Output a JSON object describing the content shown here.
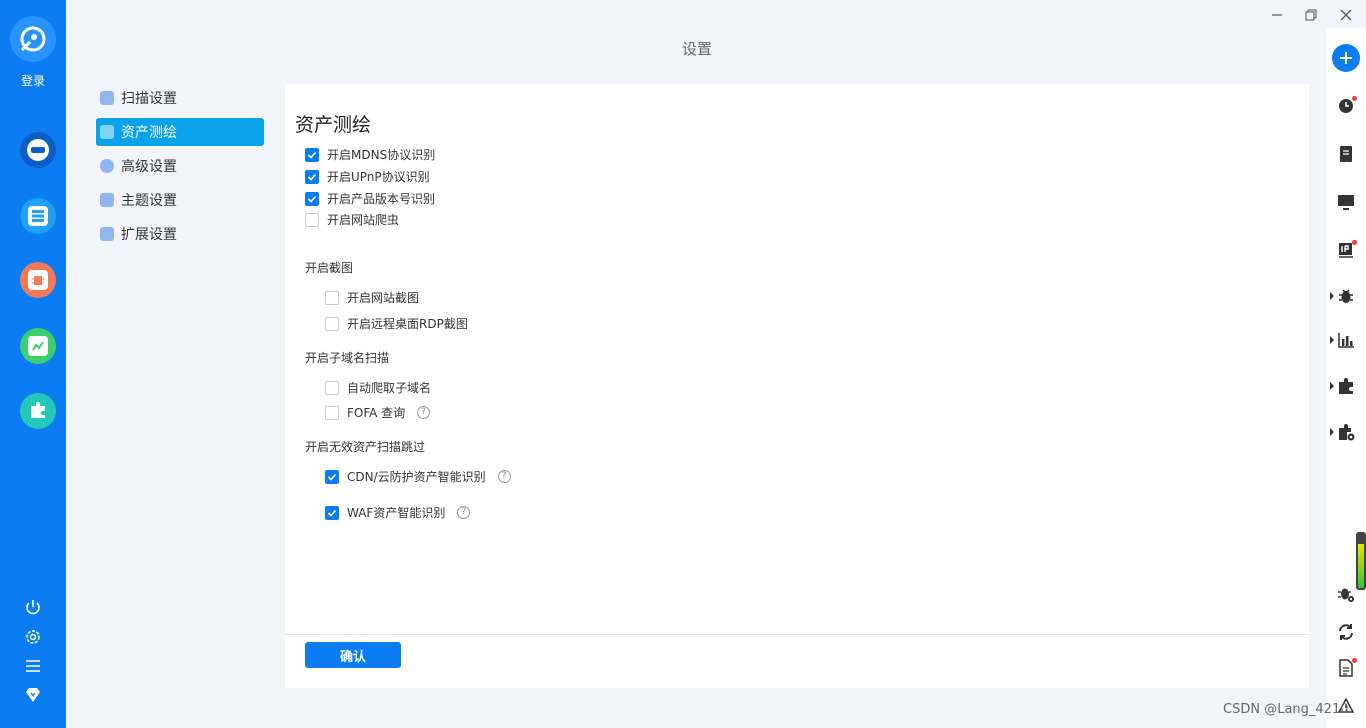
{
  "sidebar": {
    "login_label": "登录",
    "colors": [
      "#0b7cf2",
      "#1ea0f6",
      "#f07a57",
      "#3ccf6e",
      "#22c9b8"
    ],
    "items": [
      "hacker-icon",
      "server-list-icon",
      "vulnerability-icon",
      "chart-icon",
      "plugin-icon"
    ]
  },
  "header": {
    "title": "设置"
  },
  "settings_nav": {
    "items": [
      {
        "label": "扫描设置",
        "icon": "scan-icon"
      },
      {
        "label": "资产测绘",
        "icon": "asset-icon"
      },
      {
        "label": "高级设置",
        "icon": "gear-icon"
      },
      {
        "label": "主题设置",
        "icon": "shirt-icon"
      },
      {
        "label": "扩展设置",
        "icon": "puzzle-icon"
      }
    ],
    "active_index": 1
  },
  "content": {
    "section_title": "资产测绘",
    "main_options": [
      {
        "label": "开启MDNS协议识别",
        "checked": true
      },
      {
        "label": "开启UPnP协议识别",
        "checked": true
      },
      {
        "label": "开启产品版本号识别",
        "checked": true
      },
      {
        "label": "开启网站爬虫",
        "checked": false
      }
    ],
    "screenshot_group": {
      "label": "开启截图",
      "options": [
        {
          "label": "开启网站截图",
          "checked": false
        },
        {
          "label": "开启远程桌面RDP截图",
          "checked": false
        }
      ]
    },
    "subdomain_group": {
      "label": "开启子域名扫描",
      "options": [
        {
          "label": "自动爬取子域名",
          "checked": false
        },
        {
          "label": "FOFA 查询",
          "checked": false,
          "help": true
        }
      ]
    },
    "skip_group": {
      "label": "开启无效资产扫描跳过",
      "options": [
        {
          "label": "CDN/云防护资产智能识别",
          "checked": true,
          "help": true
        },
        {
          "label": "WAF资产智能识别",
          "checked": true,
          "help": true
        }
      ]
    },
    "confirm_label": "确认",
    "help_symbol": "?"
  },
  "watermark": "CSDN @Lang_4210",
  "accent_color": "#0b7cf2"
}
